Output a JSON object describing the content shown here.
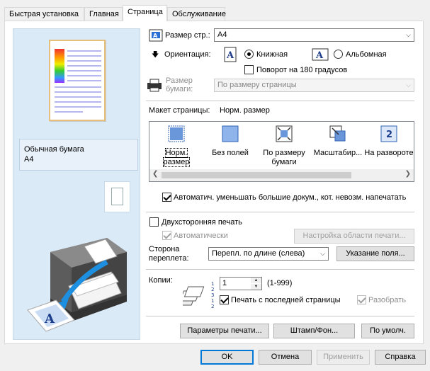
{
  "tabs": [
    {
      "label": "Быстрая установка"
    },
    {
      "label": "Главная"
    },
    {
      "label": "Страница"
    },
    {
      "label": "Обслуживание"
    }
  ],
  "preview": {
    "media_type": "Обычная бумага",
    "media_size": "A4"
  },
  "page_size": {
    "label": "Размер стр.:",
    "value": "A4"
  },
  "orientation": {
    "label": "Ориентация:",
    "portrait": "Книжная",
    "landscape": "Альбомная",
    "rotate180": "Поворот на 180 градусов"
  },
  "paper_size": {
    "label_line1": "Размер",
    "label_line2": "бумаги:",
    "value": "По размеру страницы"
  },
  "page_layout": {
    "label": "Макет страницы:",
    "current": "Норм. размер",
    "items": [
      {
        "line1": "Норм.",
        "line2": "размер"
      },
      {
        "line1": "Без полей",
        "line2": ""
      },
      {
        "line1": "По размеру",
        "line2": "бумаги"
      },
      {
        "line1": "Масштабир...",
        "line2": ""
      },
      {
        "line1": "На развороте",
        "line2": ""
      }
    ],
    "auto_reduce": "Автоматич. уменьшать большие докум., кот. невозм. напечатать"
  },
  "duplex": {
    "label": "Двухсторонняя печать",
    "auto": "Автоматически",
    "area_button": "Настройка области печати..."
  },
  "binding": {
    "label_line1": "Сторона",
    "label_line2": "переплета:",
    "value": "Перепл. по длине (слева)",
    "margin_button": "Указание поля..."
  },
  "copies": {
    "label": "Копии:",
    "value": "1",
    "range": "(1-999)",
    "reverse": "Печать с последней страницы",
    "collate": "Разобрать"
  },
  "buttons": {
    "print_options": "Параметры печати...",
    "stamp": "Штамп/Фон...",
    "defaults": "По умолч.",
    "ok": "OK",
    "cancel": "Отмена",
    "apply": "Применить",
    "help": "Справка"
  }
}
